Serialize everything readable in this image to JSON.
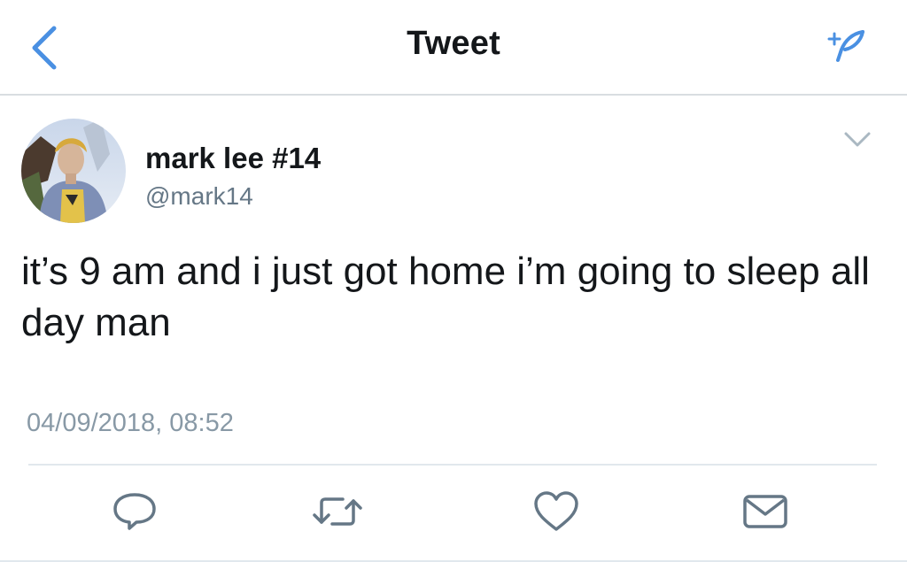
{
  "header": {
    "title": "Tweet",
    "back_icon": "chevron-left-icon",
    "compose_icon": "compose-tweet-icon",
    "accent_color": "#4a90e2"
  },
  "tweet": {
    "author": {
      "name": "mark lee #14",
      "handle": "@mark14",
      "avatar_icon": "profile-photo"
    },
    "text": "it’s 9 am and i just got home i’m going to sleep all day man",
    "timestamp": "04/09/2018, 08:52",
    "menu_icon": "chevron-down-icon"
  },
  "actions": [
    {
      "name": "reply",
      "icon": "reply-icon"
    },
    {
      "name": "retweet",
      "icon": "retweet-icon"
    },
    {
      "name": "like",
      "icon": "heart-icon"
    },
    {
      "name": "direct-message",
      "icon": "envelope-icon"
    }
  ],
  "colors": {
    "text_primary": "#14171a",
    "text_secondary": "#657786",
    "icon_gray": "#657786",
    "divider": "#e1e8ed"
  }
}
